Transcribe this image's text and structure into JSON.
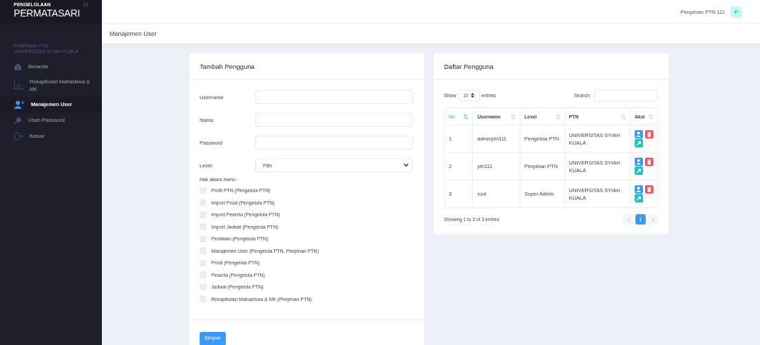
{
  "sidebar": {
    "brand_small": "PENGELOLAAN",
    "brand": "PERMATASARI",
    "role": "PIMPINAN PTN",
    "institution": "UNIVERSITAS SYIAH KUALA",
    "items": [
      {
        "label": "Beranda",
        "kind": "home",
        "selected": false
      },
      {
        "label": "Rekapitulasi Mahasiswa & MK",
        "kind": "chart",
        "selected": false
      },
      {
        "label": "Manajemen User",
        "kind": "user",
        "selected": true
      },
      {
        "label": "Ubah Password",
        "kind": "key",
        "selected": false
      },
      {
        "label": "Keluar",
        "kind": "exit",
        "selected": false
      }
    ]
  },
  "topbar": {
    "user_name": "Pimpinan PTN 111",
    "avatar": "P"
  },
  "breadcrumb": "Manajemen User",
  "form": {
    "title": "Tambah Pengguna",
    "fields": [
      {
        "label": "Username",
        "kind": "text"
      },
      {
        "label": "Nama",
        "kind": "text"
      },
      {
        "label": "Password",
        "kind": "password"
      },
      {
        "label": "Level",
        "kind": "select",
        "value": "Pilih"
      }
    ],
    "access_label": "Hak akses menu :",
    "access_items": [
      {
        "label": "Profil PTN (Pengelola PTN)",
        "checked": false
      },
      {
        "label": "Import Prodi (Pengelola PTN)",
        "checked": false
      },
      {
        "label": "Import Peserta (Pengelola PTN)",
        "checked": false
      },
      {
        "label": "Import Jadwal (Pengelola PTN)",
        "checked": false
      },
      {
        "label": "Penilaian (Pengelola PTN)",
        "checked": false
      },
      {
        "label": "Manajemen User (Pengelola PTN, Pimpinan PTN)",
        "checked": false
      },
      {
        "label": "Prodi (Pengelola PTN)",
        "checked": false
      },
      {
        "label": "Peserta (Pengelola PTN)",
        "checked": false
      },
      {
        "label": "Jadwal (Pengelola PTN)",
        "checked": false
      },
      {
        "label": "Rekapitulasi Mahasiswa & MK (Pimpinan PTN)",
        "checked": false
      }
    ],
    "submit": "Simpan"
  },
  "users": {
    "title": "Daftar Pengguna",
    "show": "Show",
    "page_size": "10",
    "entries": "entries",
    "search_label": "Search:",
    "columns": [
      {
        "label": "No",
        "sorted": true
      },
      {
        "label": "Username",
        "sorted": false
      },
      {
        "label": "Level",
        "sorted": false
      },
      {
        "label": "PTN",
        "sorted": false
      },
      {
        "label": "Aksi",
        "sorted": false
      }
    ],
    "rows": [
      {
        "no": "1",
        "username": "adminptn111",
        "level": "Pengelola PTN",
        "ptn": "UNIVERSITAS SYIAH KUALA"
      },
      {
        "no": "2",
        "username": "ptn111",
        "level": "Pimpinan PTN",
        "ptn": "UNIVERSITAS SYIAH KUALA"
      },
      {
        "no": "3",
        "username": "root",
        "level": "Super Admin",
        "ptn": "UNIVERSITAS SYIAH KUALA"
      }
    ],
    "info": "Showing 1 to 3 of 3 entries",
    "pages": [
      {
        "label": "1",
        "selected": true
      }
    ]
  }
}
